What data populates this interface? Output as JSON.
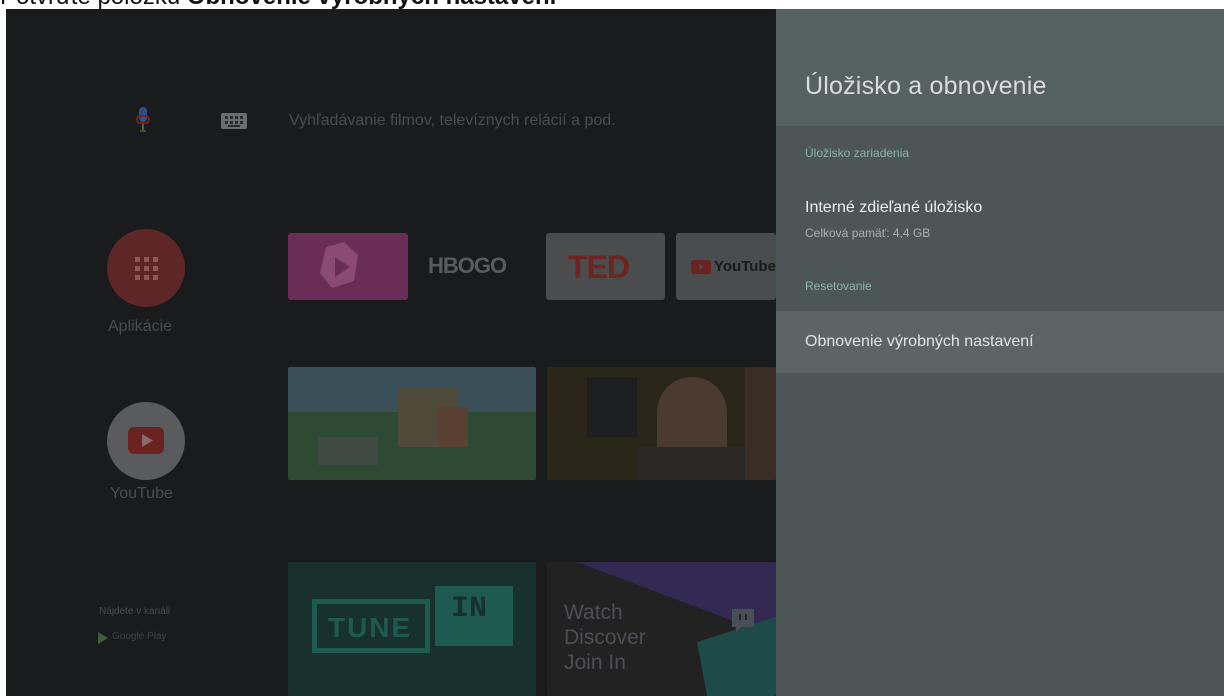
{
  "caption": {
    "prefix": "Potvrďte položku ",
    "bold": "Obnovenie výrobných nastavení"
  },
  "search": {
    "placeholder": "Vyhľadávanie filmov, televíznych relácií a pod."
  },
  "sidebar": {
    "apps_label": "Aplikácie",
    "youtube_label": "YouTube",
    "channels_label": "Nájdete v kanáli",
    "google_play_label": "Google Play"
  },
  "tiles": {
    "hbo": "HBOGO",
    "ted": "TED",
    "youtube": "YouTube",
    "tunein_left": "TUNE",
    "tunein_right": "IN",
    "twitch_lines": [
      "Watch",
      "Discover",
      "Join In"
    ]
  },
  "panel": {
    "title": "Úložisko a obnovenie",
    "section_device": "Úložisko zariadenia",
    "internal_title": "Interné zdieľané úložisko",
    "internal_sub": "Celková pamäť: 4,4 GB",
    "section_reset": "Resetovanie",
    "factory_reset": "Obnovenie výrobných nastavení"
  },
  "colors": {
    "panel_bg": "#4c5657",
    "panel_header": "#566161",
    "section_accent": "#8fb3aa",
    "selected_bg": "#5c6566"
  },
  "icons": [
    "mic-icon",
    "keyboard-icon",
    "apps-grid-icon",
    "youtube-play-icon",
    "google-play-icon",
    "twitch-icon"
  ]
}
